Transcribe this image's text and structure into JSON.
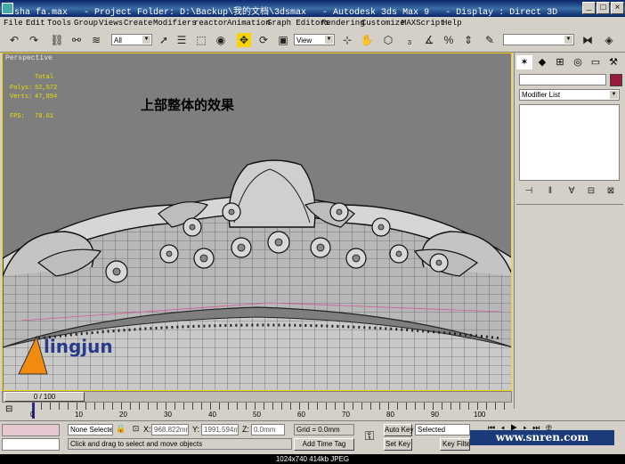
{
  "titlebar": {
    "title": "sha fa.max   - Project Folder: D:\\Backup\\我的文档\\3dsmax   - Autodesk 3ds Max 9   - Display : Direct 3D",
    "minimize": "_",
    "maximize": "□",
    "close": "×"
  },
  "menu": [
    "File",
    "Edit",
    "Tools",
    "Group",
    "Views",
    "Create",
    "Modifiers",
    "reactor",
    "Animation",
    "Graph Editors",
    "Rendering",
    "Customize",
    "MAXScript",
    "Help"
  ],
  "toolbar": {
    "selection_filter": "All",
    "reference_coord": "View"
  },
  "viewport": {
    "label": "Perspective",
    "stats_header": "Total",
    "polys_label": "Polys:",
    "polys_value": "52,572",
    "verts_label": "Verts:",
    "verts_value": "47,894",
    "fps_label": "FPS:",
    "fps_value": "78.61",
    "annotation": "上部整体的效果"
  },
  "command_panel": {
    "modifier_list": "Modifier List"
  },
  "timeline": {
    "frame_display": "0 / 100",
    "ticks": [
      "0",
      "10",
      "20",
      "30",
      "40",
      "50",
      "60",
      "70",
      "80",
      "90",
      "100"
    ]
  },
  "status": {
    "selection": "None Selecte",
    "x_label": "X:",
    "x_value": "968.822mm",
    "y_label": "Y:",
    "y_value": "1991.594m",
    "z_label": "Z:",
    "z_value": "0.0mm",
    "grid": "Grid = 0.0mm",
    "prompt": "Click and drag to select and move objects",
    "add_time_tag": "Add Time Tag",
    "auto_key": "Auto Key",
    "set_key": "Set Key",
    "key_filter_value": "Selected",
    "key_filters": "Key Filters..."
  },
  "watermark": "www.snren.com",
  "logo_text": "lingjun",
  "info": "1024x740  414kb  JPEG"
}
